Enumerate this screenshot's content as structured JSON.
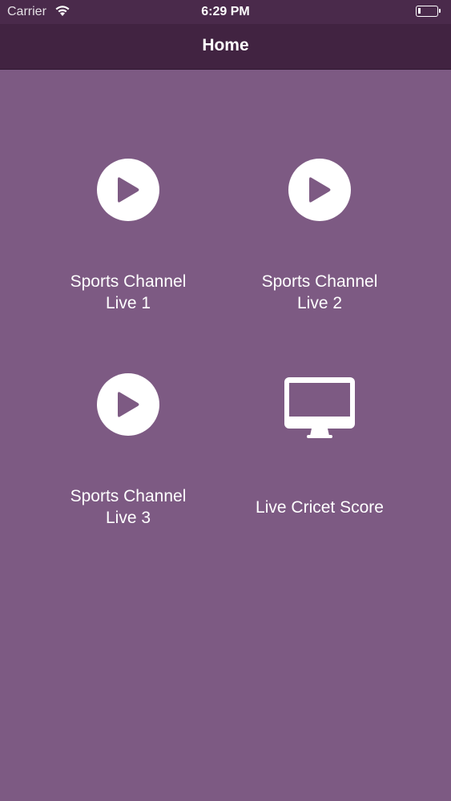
{
  "status_bar": {
    "carrier": "Carrier",
    "time": "6:29 PM",
    "icons": [
      "wifi-icon",
      "battery-icon"
    ]
  },
  "nav": {
    "title": "Home"
  },
  "tiles": [
    {
      "label": "Sports Channel\nLive 1",
      "icon": "play-icon"
    },
    {
      "label": "Sports Channel\nLive 2",
      "icon": "play-icon"
    },
    {
      "label": "Sports Channel\nLive 3",
      "icon": "play-icon"
    },
    {
      "label": "Live Cricet Score",
      "icon": "monitor-icon"
    }
  ],
  "colors": {
    "background": "#7d5a83",
    "nav_background": "#412341",
    "icon": "#ffffff",
    "accent": "#7d5a83"
  }
}
